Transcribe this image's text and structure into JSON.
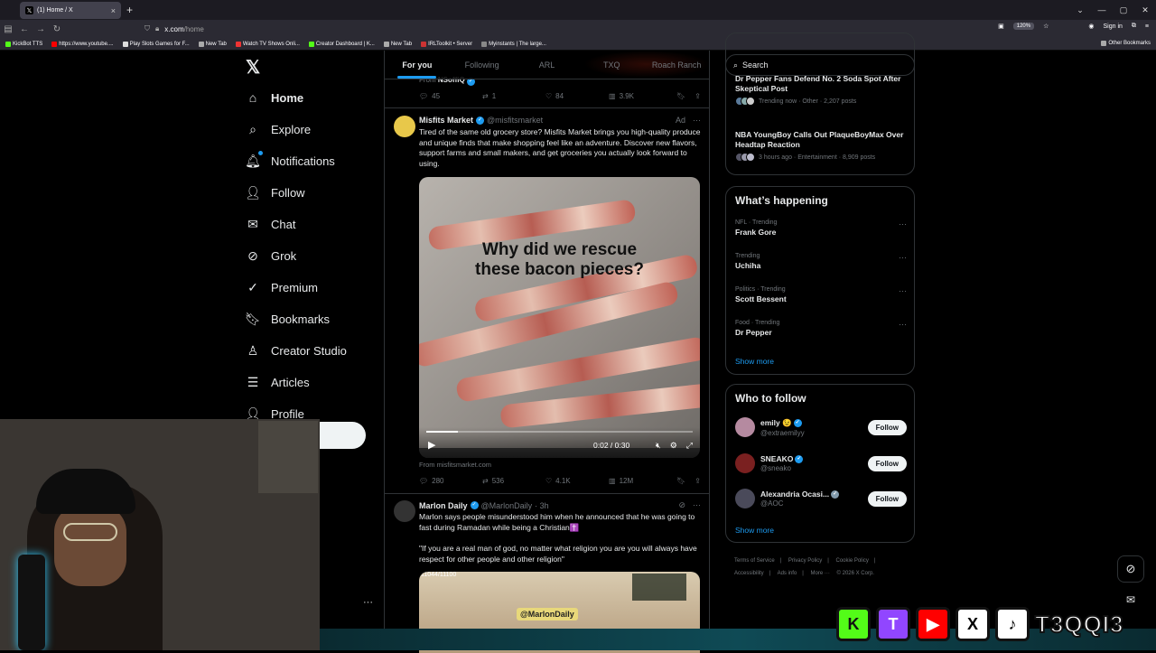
{
  "browser": {
    "tab_title": "(1) Home / X",
    "url_host": "x.com",
    "url_path": "/home",
    "zoom": "120%",
    "sign_in": "Sign in",
    "bookmarks": [
      "KickBot TTS",
      "https://www.youtube....",
      "Play Slots Games for F...",
      "New Tab",
      "Watch TV Shows Onli...",
      "Creator Dashboard | K...",
      "New Tab",
      "IRLToolkit • Server",
      "Myinstants | The large..."
    ],
    "other_bookmarks": "Other Bookmarks"
  },
  "nav": {
    "items": [
      {
        "label": "Home",
        "icon": "home-icon",
        "glyph": "⌂"
      },
      {
        "label": "Explore",
        "icon": "search-icon",
        "glyph": "⌕"
      },
      {
        "label": "Notifications",
        "icon": "bell-icon",
        "glyph": "🔔︎"
      },
      {
        "label": "Follow",
        "icon": "add-person-icon",
        "glyph": "👤︎"
      },
      {
        "label": "Chat",
        "icon": "mail-icon",
        "glyph": "✉"
      },
      {
        "label": "Grok",
        "icon": "grok-icon",
        "glyph": "⊘"
      },
      {
        "label": "Premium",
        "icon": "premium-icon",
        "glyph": "✓"
      },
      {
        "label": "Bookmarks",
        "icon": "bookmark-icon",
        "glyph": "🔖︎"
      },
      {
        "label": "Creator Studio",
        "icon": "creator-icon",
        "glyph": "♙"
      },
      {
        "label": "Articles",
        "icon": "articles-icon",
        "glyph": "☰"
      },
      {
        "label": "Profile",
        "icon": "profile-icon",
        "glyph": "👤︎"
      }
    ]
  },
  "feed": {
    "tabs": [
      "For you",
      "Following",
      "ARL",
      "TXQ",
      "Roach Ranch"
    ],
    "prev_from_prefix": "From",
    "prev_from_name": "NSoffiQ",
    "prev_actions": {
      "replies": "45",
      "reposts": "1",
      "likes": "84",
      "views": "3.9K"
    },
    "ad_post": {
      "name": "Misfits Market",
      "handle": "@misfitsmarket",
      "ad_label": "Ad",
      "text": "Tired of the same old grocery store? Misfits Market brings you high-quality produce and unique finds that make shopping feel like an adventure. Discover new flavors, support farms and small makers, and get groceries you actually look forward to using.",
      "video_caption_line1": "Why did we rescue",
      "video_caption_line2": "these bacon pieces?",
      "video_time": "0:02 / 0:30",
      "video_progress": 0.12,
      "from_link": "From misfitsmarket.com",
      "actions": {
        "replies": "280",
        "reposts": "536",
        "likes": "4.1K",
        "views": "12M"
      }
    },
    "post2": {
      "name": "Marlon Daily",
      "handle": "@MarlonDaily",
      "time": "· 3h",
      "text1": "Marlon says people misunderstood him when he announced that he was going to fast during Ramadan while being a Christian✝️",
      "text2": "\"If you are a real man of god, no matter what religion you are you will always have respect for other people and other religion\"",
      "media_counter": "11044/11100",
      "media_tag": "@MarlonDaily"
    }
  },
  "right": {
    "search_placeholder": "Search",
    "news": [
      {
        "title": "Dr Pepper Fans Defend No. 2 Soda Spot After Skeptical Post",
        "meta": "Trending now · Other · 2,207 posts"
      },
      {
        "title": "NBA YoungBoy Calls Out PlaqueBoyMax Over Headtap Reaction",
        "meta": "3 hours ago · Entertainment · 8,909 posts"
      }
    ],
    "whats_happening_title": "What’s happening",
    "trends": [
      {
        "meta": "NFL · Trending",
        "title": "Frank Gore"
      },
      {
        "meta": "Trending",
        "title": "Uchiha"
      },
      {
        "meta": "Politics · Trending",
        "title": "Scott Bessent"
      },
      {
        "meta": "Food · Trending",
        "title": "Dr Pepper"
      }
    ],
    "show_more": "Show more",
    "who_to_follow_title": "Who to follow",
    "who_to_follow": [
      {
        "name": "emily 😉",
        "handle": "@extraemilyy",
        "button": "Follow",
        "color": "#b58aa0"
      },
      {
        "name": "SNEAKO",
        "handle": "@sneako",
        "button": "Follow",
        "color": "#7a2020"
      },
      {
        "name": "Alexandria Ocasi...",
        "handle": "@AOC",
        "button": "Follow",
        "color": "#4a4a5a"
      }
    ],
    "footer": [
      "Terms of Service",
      "|",
      "Privacy Policy",
      "|",
      "Cookie Policy",
      "|",
      "Accessibility",
      "|",
      "Ads info",
      "|",
      "More ···",
      "© 2026 X Corp."
    ]
  },
  "overlay": {
    "brand": "T3QQI3",
    "social_icons": [
      "K",
      "T",
      "▶",
      "X",
      "♪"
    ]
  },
  "colors": {
    "accent": "#1d9bf0",
    "bg": "#000000",
    "border": "#2f3336",
    "muted": "#71767b"
  }
}
